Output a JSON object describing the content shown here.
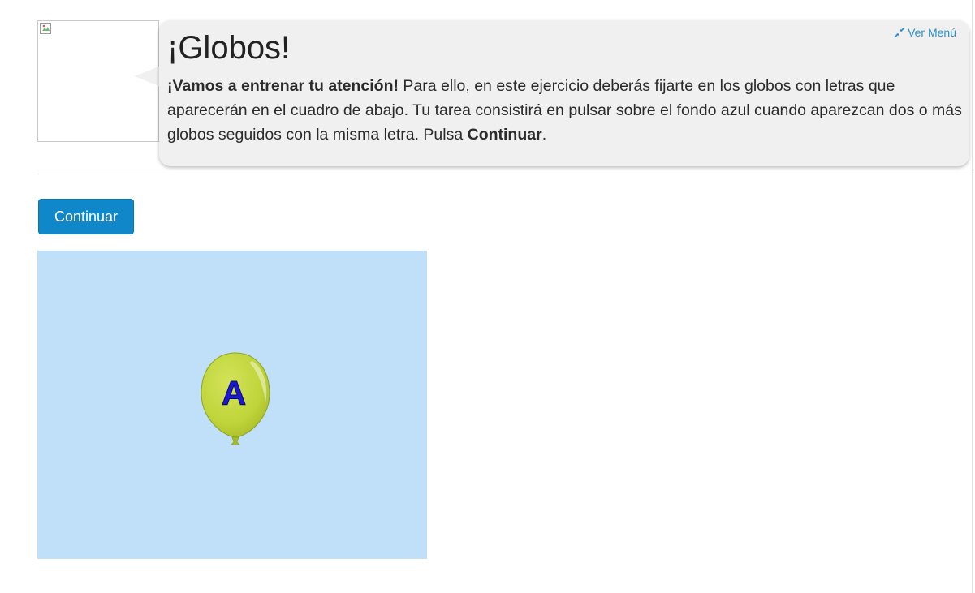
{
  "header": {
    "menu_link": "Ver Menú",
    "menu_icon": "compress-icon"
  },
  "avatar": {
    "icon": "broken-image-icon"
  },
  "exercise": {
    "title": "¡Globos!",
    "intro_bold": "¡Vamos a entrenar tu atención!",
    "intro_text": " Para ello, en este ejercicio deberás fijarte en los globos con letras que aparecerán en el cuadro de abajo. Tu tarea consistirá en pulsar sobre el fondo azul cuando aparezcan dos o más globos seguidos con la misma letra. Pulsa ",
    "continue_bold": "Continuar",
    "end_period": "."
  },
  "actions": {
    "continue_label": "Continuar"
  },
  "game": {
    "background_color": "#bfe0f8",
    "balloon": {
      "letter": "A",
      "color": "#bfd43a",
      "letter_color": "#1a17d6"
    }
  },
  "colors": {
    "accent": "#0f87c9",
    "link": "#2a8fd0",
    "bubble": "#f0f0f0"
  }
}
